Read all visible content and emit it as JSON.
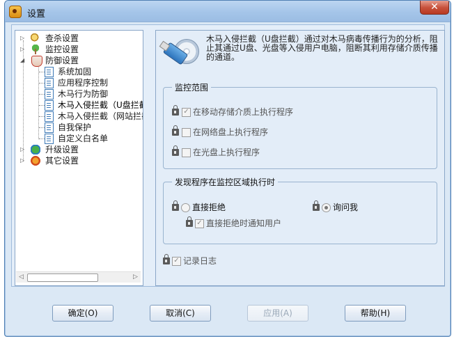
{
  "window": {
    "title": "设置",
    "close_glyph": "✕"
  },
  "tree": {
    "items": [
      {
        "label": "查杀设置"
      },
      {
        "label": "监控设置"
      },
      {
        "label": "防御设置"
      },
      {
        "label": "系统加固"
      },
      {
        "label": "应用程序控制"
      },
      {
        "label": "木马行为防御"
      },
      {
        "label": "木马入侵拦截（U盘拦截）"
      },
      {
        "label": "木马入侵拦截（网站拦截）"
      },
      {
        "label": "自我保护"
      },
      {
        "label": "自定义白名单"
      },
      {
        "label": "升级设置"
      },
      {
        "label": "其它设置"
      }
    ]
  },
  "panel": {
    "description": "木马入侵拦截（U盘拦截）通过对木马病毒传播行为的分析，阻止其通过U盘、光盘等入侵用户电脑，阻断其利用存储介质传播的通道。",
    "monitor_group": {
      "title": "监控范围",
      "options": [
        {
          "label": "在移动存储介质上执行程序",
          "checked": true
        },
        {
          "label": "在网络盘上执行程序",
          "checked": false
        },
        {
          "label": "在光盘上执行程序",
          "checked": false
        }
      ]
    },
    "action_group": {
      "title": "发现程序在监控区域执行时",
      "reject_label": "直接拒绝",
      "ask_label": "询问我",
      "notify_label": "直接拒绝时通知用户"
    },
    "log_label": "记录日志"
  },
  "buttons": {
    "ok": "确定(O)",
    "cancel": "取消(C)",
    "apply": "应用(A)",
    "help": "帮助(H)"
  },
  "colors": {
    "window_bg": "#dbe8f5",
    "title_bar": "#a5c5e9",
    "close_red": "#c7513b"
  }
}
